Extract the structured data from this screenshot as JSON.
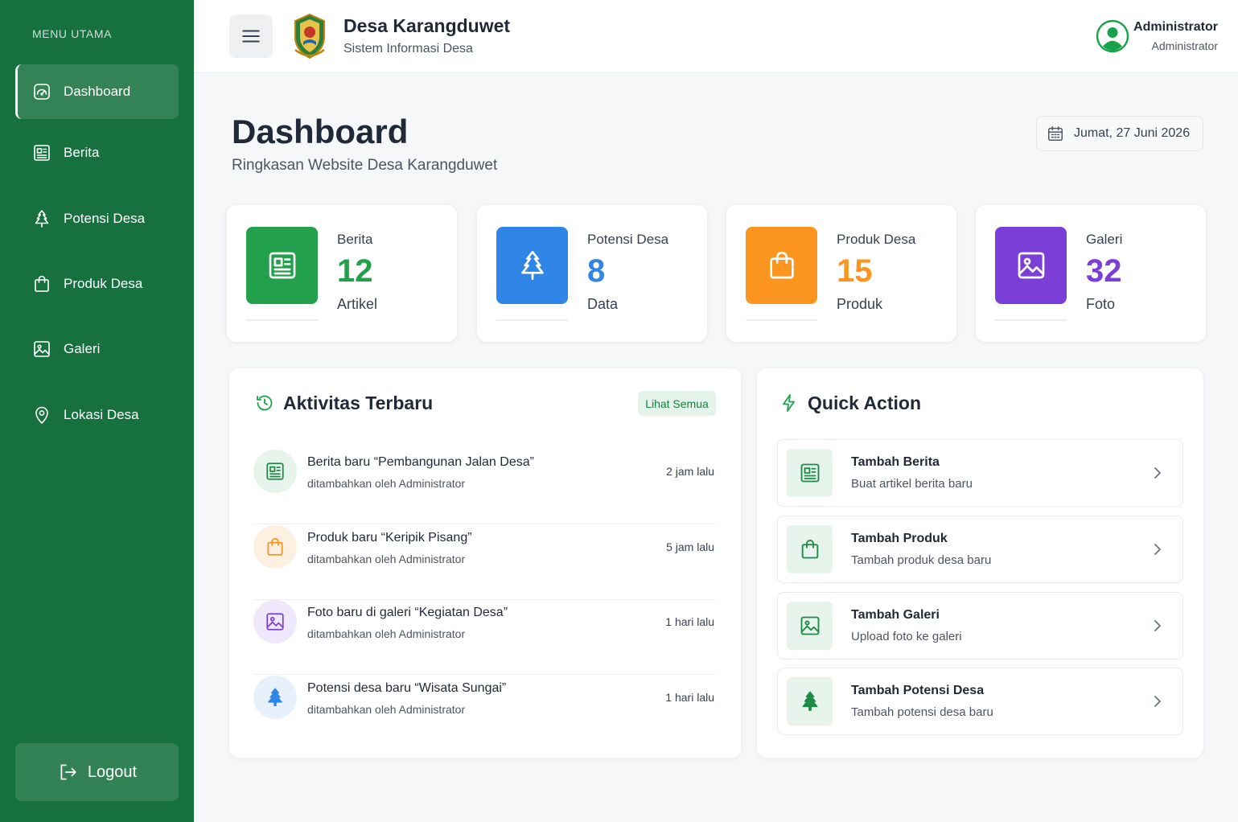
{
  "sidebar": {
    "menu_title": "MENU UTAMA",
    "items": [
      {
        "label": "Dashboard",
        "icon": "dashboard-icon",
        "active": true
      },
      {
        "label": "Berita",
        "icon": "newspaper-icon"
      },
      {
        "label": "Potensi Desa",
        "icon": "tree-icon"
      },
      {
        "label": "Produk Desa",
        "icon": "shopping-bag-icon"
      },
      {
        "label": "Galeri",
        "icon": "image-icon"
      },
      {
        "label": "Lokasi Desa",
        "icon": "map-pin-icon"
      }
    ],
    "logout_label": "Logout"
  },
  "header": {
    "title": "Desa Karangduwet",
    "subtitle": "Sistem Informasi Desa",
    "user_name": "Administrator",
    "user_role": "Administrator"
  },
  "page": {
    "title": "Dashboard",
    "subtitle": "Ringkasan Website Desa Karangduwet",
    "date": "Jumat, 27 Juni 2026"
  },
  "stats": [
    {
      "label": "Berita",
      "value": "12",
      "unit": "Artikel",
      "color": "#22a04b",
      "icon": "newspaper-icon"
    },
    {
      "label": "Potensi Desa",
      "value": "8",
      "unit": "Data",
      "color": "#2f86e6",
      "icon": "tree-icon"
    },
    {
      "label": "Produk Desa",
      "value": "15",
      "unit": "Produk",
      "color": "#fb9520",
      "icon": "shopping-bag-icon"
    },
    {
      "label": "Galeri",
      "value": "32",
      "unit": "Foto",
      "color": "#7b3fd8",
      "icon": "image-icon"
    }
  ],
  "activity": {
    "title": "Aktivitas Terbaru",
    "see_all": "Lihat Semua",
    "items": [
      {
        "title": "Berita baru “Pembangunan Jalan Desa”",
        "meta": "ditambahkan oleh Administrator",
        "time": "2 jam lalu",
        "icon": "newspaper-icon"
      },
      {
        "title": "Produk baru “Keripik Pisang”",
        "meta": "ditambahkan oleh Administrator",
        "time": "5 jam lalu",
        "icon": "shopping-bag-icon"
      },
      {
        "title": "Foto baru di galeri “Kegiatan Desa”",
        "meta": "ditambahkan oleh Administrator",
        "time": "1 hari lalu",
        "icon": "image-icon"
      },
      {
        "title": "Potensi desa baru “Wisata Sungai”",
        "meta": "ditambahkan oleh Administrator",
        "time": "1 hari lalu",
        "icon": "tree-icon"
      }
    ]
  },
  "quick_action": {
    "title": "Quick Action",
    "items": [
      {
        "title": "Tambah Berita",
        "sub": "Buat artikel berita baru",
        "icon": "newspaper-icon"
      },
      {
        "title": "Tambah Produk",
        "sub": "Tambah produk desa baru",
        "icon": "shopping-bag-icon"
      },
      {
        "title": "Tambah Galeri",
        "sub": "Upload foto ke galeri",
        "icon": "image-icon"
      },
      {
        "title": "Tambah Potensi Desa",
        "sub": "Tambah potensi desa baru",
        "icon": "tree-icon"
      }
    ]
  }
}
